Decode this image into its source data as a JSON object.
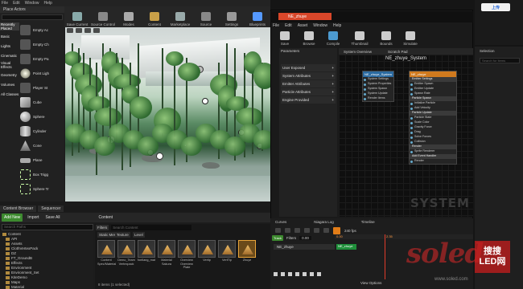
{
  "main_window": {
    "menu": [
      "File",
      "Edit",
      "Window",
      "Help"
    ],
    "tab": "Place Actors",
    "toolbar": [
      {
        "label": "Save Current",
        "color": "#8aa"
      },
      {
        "label": "Source Control",
        "color": "#888"
      },
      {
        "label": "Modes",
        "color": "#aaa"
      },
      {
        "label": "Content",
        "color": "#c9a048"
      },
      {
        "label": "Marketplace",
        "color": "#9aa"
      },
      {
        "label": "Source",
        "color": "#888"
      },
      {
        "label": "Settings",
        "color": "#999"
      },
      {
        "label": "Blueprints",
        "color": "#59f"
      }
    ],
    "modes": {
      "categories": [
        "Recently Placed",
        "Basic",
        "Lights",
        "Cinematic",
        "Visual Effects",
        "Geometry",
        "Volumes",
        "All Classes"
      ],
      "active_category": "Recently Placed",
      "items": [
        {
          "label": "Empty Ac",
          "icon": "empty-actor-icon"
        },
        {
          "label": "Empty Ch",
          "icon": "empty-character-icon"
        },
        {
          "label": "Empty Pa",
          "icon": "empty-pawn-icon"
        },
        {
          "label": "Point Ligh",
          "icon": "point-light-icon"
        },
        {
          "label": "Player St",
          "icon": "player-start-icon"
        },
        {
          "label": "Cube",
          "icon": "cube-icon"
        },
        {
          "label": "Sphere",
          "icon": "sphere-icon"
        },
        {
          "label": "Cylinder",
          "icon": "cylinder-icon"
        },
        {
          "label": "Cone",
          "icon": "cone-icon"
        },
        {
          "label": "Plane",
          "icon": "plane-icon"
        },
        {
          "label": "Box Trigg",
          "icon": "box-trigger-icon"
        },
        {
          "label": "Sphere Tr",
          "icon": "sphere-trigger-icon"
        }
      ]
    }
  },
  "content_browser": {
    "tabs": [
      "Content Browser",
      "Sequencer"
    ],
    "add_new": "Add New",
    "import": "Import",
    "save_all": "Save All",
    "breadcrumb": "Content",
    "search_placeholder": "Search Paths",
    "filters": "Filters",
    "filter_chips": [
      "Static Mesh",
      "Texture",
      "Level"
    ],
    "search_assets_placeholder": "Search Content",
    "tree": [
      "Content",
      "API",
      "Assets",
      "ClothVertexPack",
      "DZ",
      "FT_GroundB",
      "Effects",
      "Environment",
      "Environment_Set",
      "KiteDemo",
      "Maps",
      "Material"
    ],
    "assets": [
      {
        "label": "Content Spec/Material",
        "selected": false
      },
      {
        "label": "Demo_Team Vertexpack",
        "selected": false
      },
      {
        "label": "fontlang_mat",
        "selected": false
      },
      {
        "label": "Material Sakura",
        "selected": false
      },
      {
        "label": "Overview Overview Plate",
        "selected": false
      },
      {
        "label": "Vertip",
        "selected": false
      },
      {
        "label": "VertTip",
        "selected": false
      },
      {
        "label": "Zhuye",
        "selected": true
      }
    ],
    "status": "8 items (1 selected)"
  },
  "cascade": {
    "tab_title": "NE_zhuye",
    "menu": [
      "File",
      "Edit",
      "Asset",
      "Window",
      "Help"
    ],
    "toolbar": [
      "Save",
      "Browse",
      "Compile",
      "Thumbnail",
      "Bounds",
      "Simulate"
    ],
    "parameters_tab": "Parameters",
    "system_overview_tab": "System Overview",
    "scratch_pad_tab": "Scratch Pad",
    "parameters": [
      "User Exposed",
      "System Attributes",
      "Emitter Attributes",
      "Particle Attributes",
      "Engine Provided"
    ],
    "system_title": "NE_zhuye_System",
    "node_system": {
      "title": "NE_zhuye_System",
      "rows": [
        "System Settings",
        "System Properties",
        "System Spawn",
        "System Update",
        "Render Items"
      ]
    },
    "node_emitter": {
      "title": "NE_zhuye",
      "rows": [
        "Emitter Settings",
        "Emitter Spawn",
        "Emitter Update",
        "Spawn Rate",
        "Particle Spawn",
        "Initialize Particle",
        "Add Velocity",
        "Particle Update",
        "Particle State",
        "Scale Color",
        "Gravity Force",
        "Drag",
        "Solve Forces",
        "Collision",
        "Render",
        "Sprite Renderer",
        "Add Event Handler",
        "Render"
      ]
    },
    "watermark": "SYSTEM",
    "selection_tab": "Selection",
    "selection_search": "Search for items"
  },
  "timeline": {
    "tabs": [
      "Curves",
      "Niagara Log",
      "Timeline"
    ],
    "track_button": "Track",
    "filters": "Filters",
    "frame": "0.00",
    "fps": "240 fps",
    "row_name": "NE_zhuye",
    "bar_label": "NE_zhuye",
    "ruler_start": "0.00",
    "ruler_mark": "2.35",
    "view_options": "View Options"
  },
  "browser": {
    "upload_label": "上传"
  },
  "watermark": {
    "text": "soled",
    "cn_badge": [
      "搜搜",
      "LED网"
    ],
    "url": "www.soled.com"
  }
}
